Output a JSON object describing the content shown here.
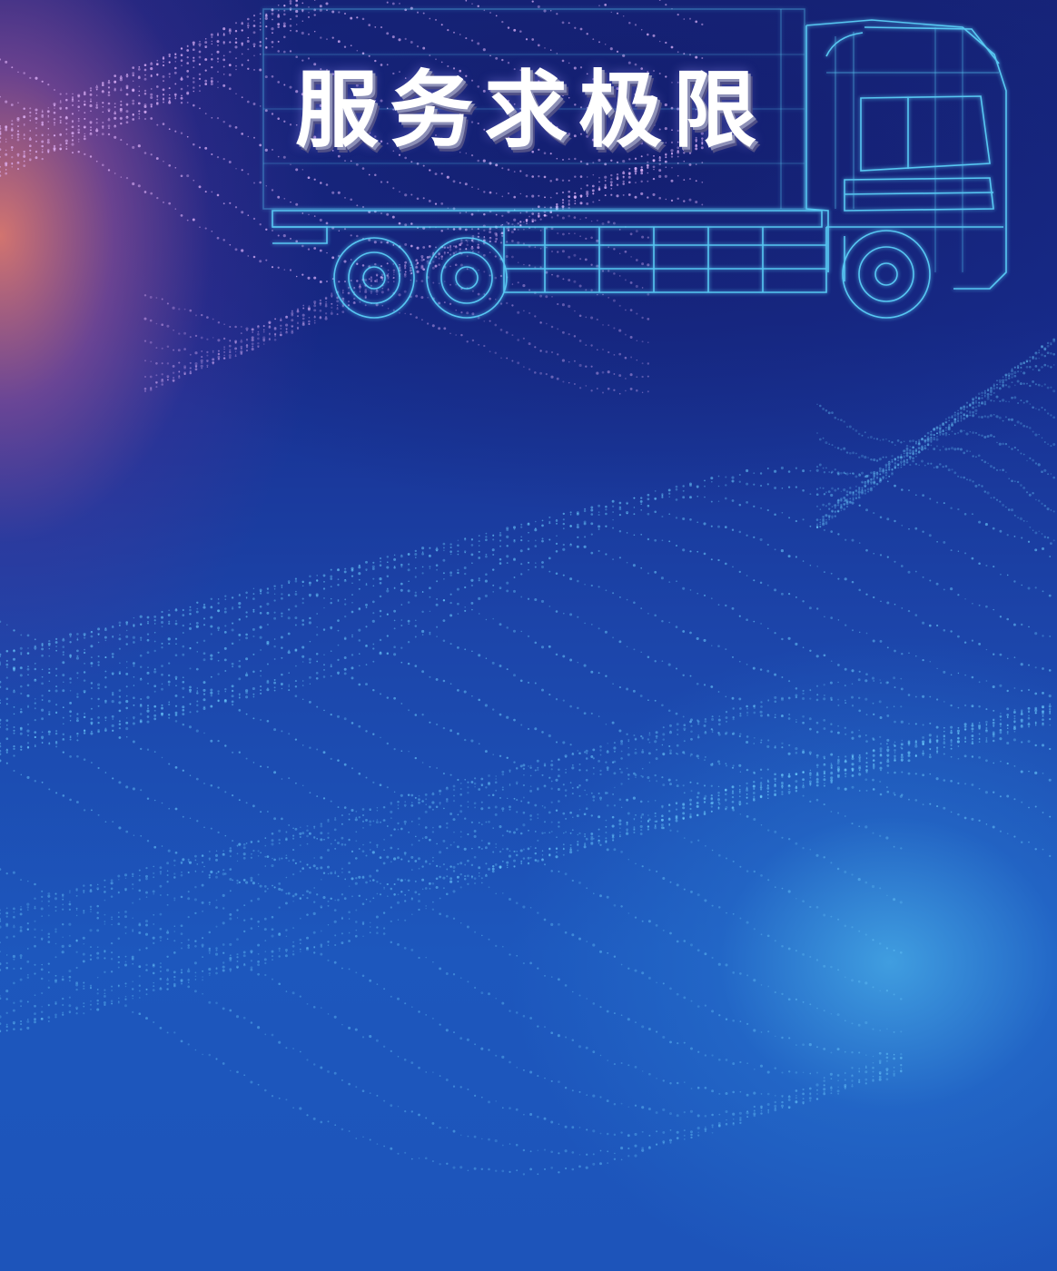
{
  "headline": {
    "text": "服务求极限"
  },
  "decorations": {
    "truck": "wireframe-truck-illustration",
    "particles": "dotted-particle-waves"
  },
  "colors": {
    "background_deep": "#16257c",
    "background_mid": "#1c45aa",
    "glow_warm": "#dc786e",
    "glow_cool": "#46aae6",
    "wireframe": "#5fd8ff",
    "particles_top": "#e6b8ff",
    "particles_bottom": "#6fd0ff",
    "headline_text": "#ffffff"
  }
}
